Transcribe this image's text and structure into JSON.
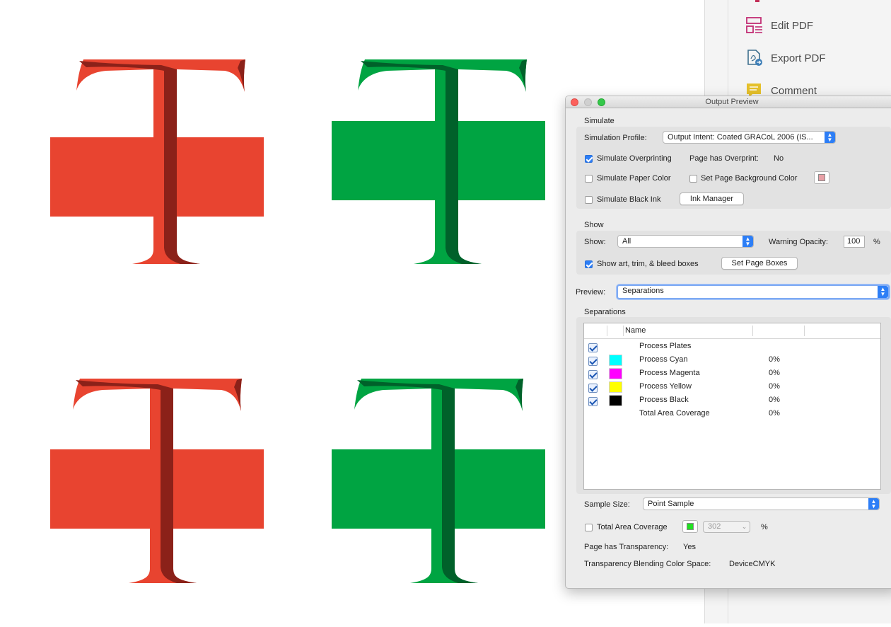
{
  "tools_pane": {
    "items": [
      {
        "label": "Edit PDF",
        "icon": "edit-pdf-icon"
      },
      {
        "label": "Export PDF",
        "icon": "export-pdf-icon"
      },
      {
        "label": "Comment",
        "icon": "comment-icon"
      }
    ]
  },
  "canvas": {
    "colors": {
      "red": "#e84430",
      "red_dark": "#8b2119",
      "green": "#00a442",
      "green_dark": "#00612a"
    }
  },
  "output_preview": {
    "title": "Output Preview",
    "simulate": {
      "heading": "Simulate",
      "profile_label": "Simulation Profile:",
      "profile_value": "Output Intent: Coated GRACoL 2006 (IS...",
      "simulate_overprinting": {
        "label": "Simulate Overprinting",
        "checked": true
      },
      "page_has_overprint_label": "Page has Overprint:",
      "page_has_overprint_value": "No",
      "simulate_paper_color": {
        "label": "Simulate Paper Color",
        "checked": false
      },
      "set_page_background": {
        "label": "Set Page Background Color",
        "checked": false,
        "color": "#e8a0a6"
      },
      "simulate_black_ink": {
        "label": "Simulate Black Ink",
        "checked": false
      },
      "ink_manager_label": "Ink Manager"
    },
    "show": {
      "heading": "Show",
      "show_label": "Show:",
      "show_value": "All",
      "warning_opacity_label": "Warning Opacity:",
      "warning_opacity_value": "100",
      "percent": "%",
      "boxes": {
        "label": "Show art, trim, & bleed boxes",
        "checked": true
      },
      "set_page_boxes_label": "Set Page Boxes"
    },
    "preview": {
      "label": "Preview:",
      "value": "Separations"
    },
    "separations": {
      "heading": "Separations",
      "name_header": "Name",
      "rows": [
        {
          "name": "Process Plates",
          "checkbox": true,
          "color": "",
          "percent": ""
        },
        {
          "name": "Process Cyan",
          "checkbox": true,
          "color": "#00ffff",
          "percent": "0%"
        },
        {
          "name": "Process Magenta",
          "checkbox": true,
          "color": "#ff00ff",
          "percent": "0%"
        },
        {
          "name": "Process Yellow",
          "checkbox": true,
          "color": "#ffff00",
          "percent": "0%"
        },
        {
          "name": "Process Black",
          "checkbox": true,
          "color": "#000000",
          "percent": "0%"
        },
        {
          "name": "Total Area Coverage",
          "checkbox": false,
          "color": "",
          "percent": "0%"
        }
      ]
    },
    "sample_size": {
      "label": "Sample Size:",
      "value": "Point Sample"
    },
    "total_area_coverage": {
      "label": "Total Area Coverage",
      "checked": false,
      "color": "#22e022",
      "value": "302",
      "percent": "%"
    },
    "page_has_transparency": {
      "label": "Page has Transparency:",
      "value": "Yes"
    },
    "blending_space": {
      "label": "Transparency Blending Color Space:",
      "value": "DeviceCMYK"
    }
  }
}
